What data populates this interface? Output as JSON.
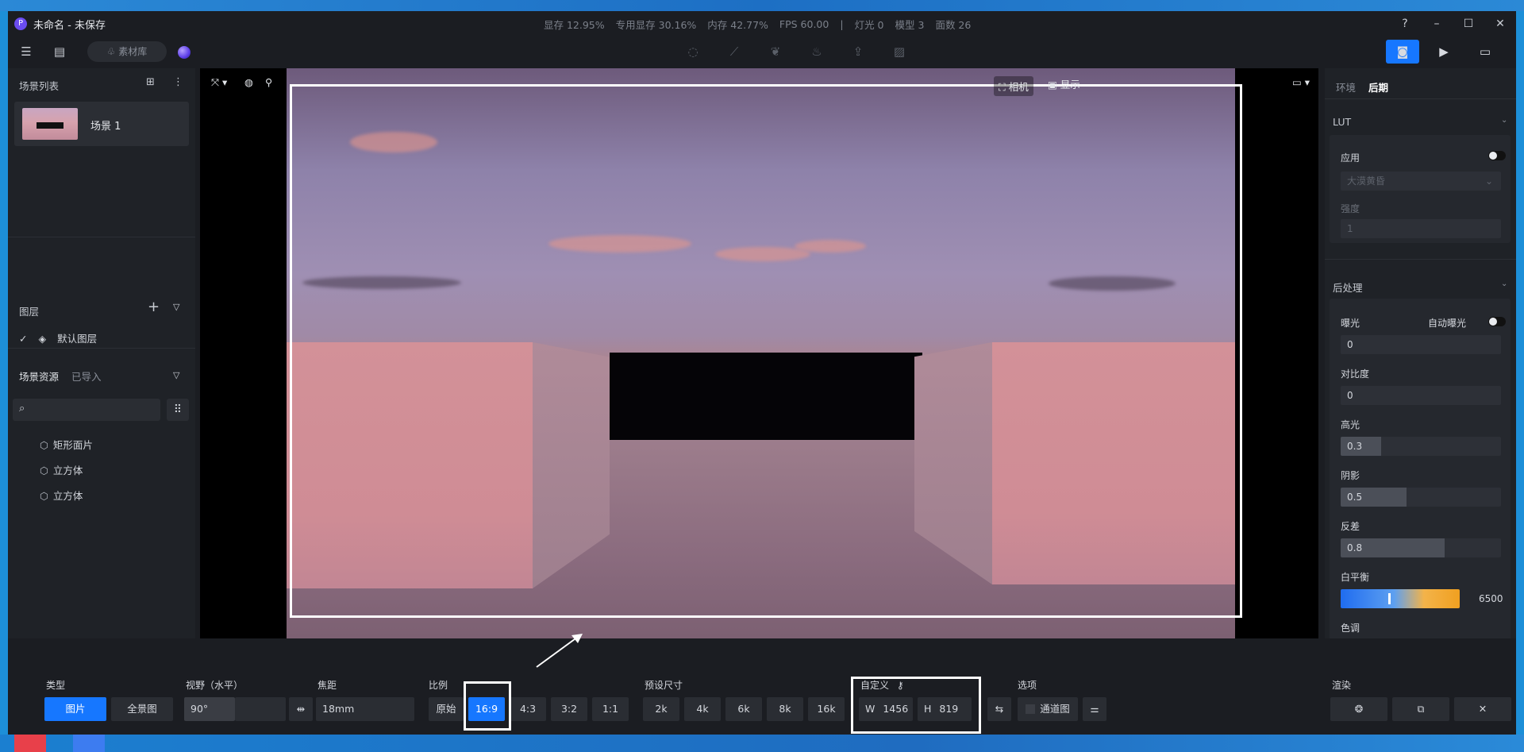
{
  "app": {
    "title": "未命名 - 未保存",
    "stats": [
      "显存 12.95%",
      "专用显存 30.16%",
      "内存 42.77%",
      "FPS 60.00",
      "|",
      "灯光 0",
      "模型 3",
      "面数 26"
    ],
    "library_label": "素材库"
  },
  "left": {
    "scene_list_title": "场景列表",
    "scene_name": "场景 1",
    "layers_title": "图层",
    "default_layer": "默认图层",
    "assets_tab": "场景资源",
    "imported_tab": "已导入",
    "search_placeholder": "",
    "assets": [
      "矩形面片",
      "立方体",
      "立方体"
    ]
  },
  "viewport": {
    "camera_label": "相机",
    "display_label": "显示"
  },
  "right": {
    "tabs": [
      "环境",
      "后期"
    ],
    "lut_title": "LUT",
    "apply_label": "应用",
    "lut_preset": "大漠黄昏",
    "intensity_label": "强度",
    "intensity_value": "1",
    "post_title": "后处理",
    "exposure_label": "曝光",
    "auto_exposure_label": "自动曝光",
    "exposure_value": "0",
    "contrast_label": "对比度",
    "contrast_value": "0",
    "highlight_label": "高光",
    "highlight_value": "0.3",
    "highlight_fill": 0.25,
    "shadow_label": "阴影",
    "shadow_value": "0.5",
    "shadow_fill": 0.41,
    "flare_label": "反差",
    "flare_value": "0.8",
    "flare_fill": 0.65,
    "wb_label": "白平衡",
    "wb_value": "6500",
    "wb_fraction": 0.4,
    "tone_label": "色调"
  },
  "bottom": {
    "type_label": "类型",
    "type_photo": "图片",
    "type_pano": "全景图",
    "fov_label": "视野（水平）",
    "fov_value": "90°",
    "focal_label": "焦距",
    "focal_value": "18mm",
    "ratio_label": "比例",
    "ratios": [
      "原始",
      "16:9",
      "4:3",
      "3:2",
      "1:1"
    ],
    "preset_label": "预设尺寸",
    "presets": [
      "2k",
      "4k",
      "6k",
      "8k",
      "16k"
    ],
    "custom_label": "自定义",
    "width_prefix": "W",
    "width_value": "1456",
    "height_prefix": "H",
    "height_value": "819",
    "options_label": "选项",
    "channel_label": "通道图",
    "render_label": "渲染"
  },
  "colors": {
    "accent": "#1677ff",
    "panel": "#1f2227",
    "background": "#1b1d22"
  }
}
